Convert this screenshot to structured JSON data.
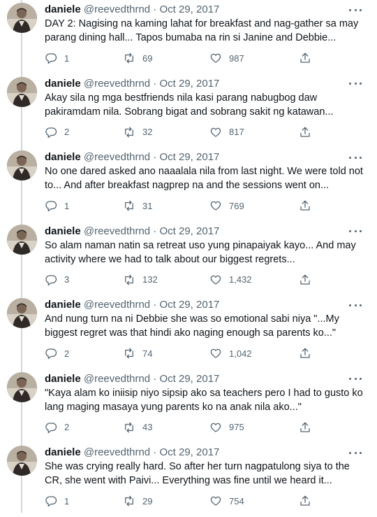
{
  "colors": {
    "text": "#0f1419",
    "secondary": "#536471",
    "thread_line": "#cfd9de",
    "background": "#ffffff"
  },
  "icons": {
    "reply": "reply-icon",
    "retweet": "retweet-icon",
    "like": "heart-icon",
    "share": "share-icon",
    "more": "more-icon"
  },
  "tweets": [
    {
      "name": "daniele",
      "handle": "@reevedthrnd",
      "dot": "·",
      "date": "Oct 29, 2017",
      "text": "DAY 2: Nagising na kaming lahat for breakfast and nag-gather sa may parang dining hall... Tapos bumaba na rin si Janine and Debbie...",
      "replies": "1",
      "retweets": "69",
      "likes": "987"
    },
    {
      "name": "daniele",
      "handle": "@reevedthrnd",
      "dot": "·",
      "date": "Oct 29, 2017",
      "text": "Akay sila ng mga bestfriends nila kasi parang nabugbog daw pakiramdam nila. Sobrang bigat and sobrang sakit ng katawan...",
      "replies": "2",
      "retweets": "32",
      "likes": "817"
    },
    {
      "name": "daniele",
      "handle": "@reevedthrnd",
      "dot": "·",
      "date": "Oct 29, 2017",
      "text": "No one dared asked ano naaalala nila from last night. We were told not to... And after breakfast nagprep na and the sessions went on...",
      "replies": "1",
      "retweets": "31",
      "likes": "769"
    },
    {
      "name": "daniele",
      "handle": "@reevedthrnd",
      "dot": "·",
      "date": "Oct 29, 2017",
      "text": "So alam naman natin sa retreat uso yung pinapaiyak kayo... And may activity where we had to talk about our biggest regrets...",
      "replies": "3",
      "retweets": "132",
      "likes": "1,432"
    },
    {
      "name": "daniele",
      "handle": "@reevedthrnd",
      "dot": "·",
      "date": "Oct 29, 2017",
      "text": "And nung turn na ni Debbie she was so emotional sabi niya \"...My biggest regret was that hindi ako naging enough sa parents ko...\"",
      "replies": "2",
      "retweets": "74",
      "likes": "1,042"
    },
    {
      "name": "daniele",
      "handle": "@reevedthrnd",
      "dot": "·",
      "date": "Oct 29, 2017",
      "text": "\"Kaya alam ko iniisip niyo sipsip ako sa teachers pero I had to gusto ko lang maging masaya yung parents ko na anak nila ako...\"",
      "replies": "2",
      "retweets": "43",
      "likes": "975"
    },
    {
      "name": "daniele",
      "handle": "@reevedthrnd",
      "dot": "·",
      "date": "Oct 29, 2017",
      "text": "She was crying really hard. So after her turn nagpatulong siya to the CR, she went with Paivi... Everything was fine until we heard it...",
      "replies": "1",
      "retweets": "29",
      "likes": "754"
    }
  ]
}
